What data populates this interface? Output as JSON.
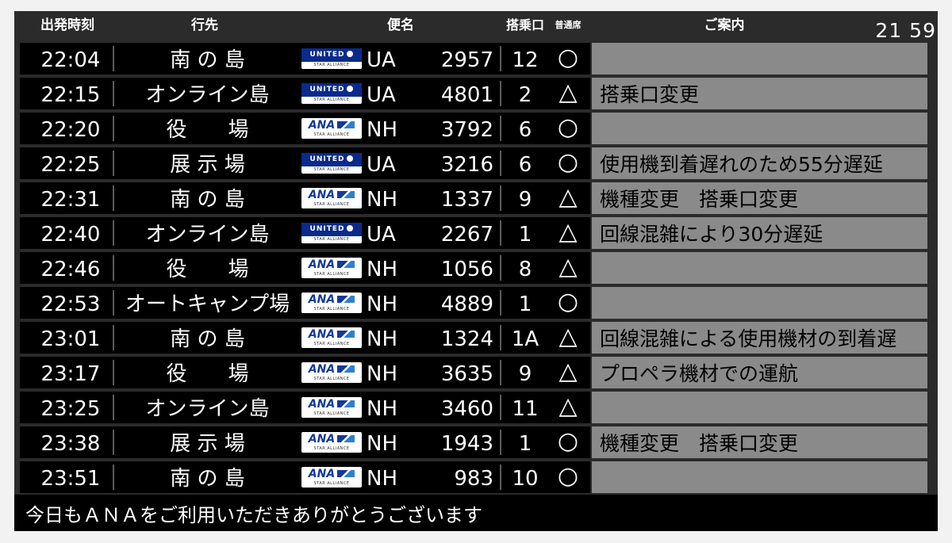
{
  "header": {
    "time_label": "出発時刻",
    "dest_label": "行先",
    "flight_label": "便名",
    "gate_label": "搭乗口",
    "seat_label": "普通席",
    "info_label": "ご案内",
    "clock": "21 59"
  },
  "colors": {
    "board": "#2b2b2b",
    "row": "#000000",
    "note": "#8a8a8a",
    "ua_blue": "#0a2a8c",
    "ana_blue": "#113a9c"
  },
  "flights": [
    {
      "time": "22:04",
      "dest": "南 の 島",
      "airline": "UA",
      "logo": "UNITED",
      "alliance": "STAR ALLIANCE",
      "number": "2957",
      "gate": "12",
      "seat": "○",
      "note": ""
    },
    {
      "time": "22:15",
      "dest": "オンライン島",
      "airline": "UA",
      "logo": "UNITED",
      "alliance": "STAR ALLIANCE",
      "number": "4801",
      "gate": "2",
      "seat": "△",
      "note": "搭乗口変更"
    },
    {
      "time": "22:20",
      "dest": "役　　場",
      "airline": "NH",
      "logo": "ANA",
      "alliance": "STAR ALLIANCE",
      "number": "3792",
      "gate": "6",
      "seat": "○",
      "note": ""
    },
    {
      "time": "22:25",
      "dest": "展 示 場",
      "airline": "UA",
      "logo": "UNITED",
      "alliance": "STAR ALLIANCE",
      "number": "3216",
      "gate": "6",
      "seat": "○",
      "note": "使用機到着遅れのため55分遅延"
    },
    {
      "time": "22:31",
      "dest": "南 の 島",
      "airline": "NH",
      "logo": "ANA",
      "alliance": "STAR ALLIANCE",
      "number": "1337",
      "gate": "9",
      "seat": "△",
      "note": "機種変更　搭乗口変更"
    },
    {
      "time": "22:40",
      "dest": "オンライン島",
      "airline": "UA",
      "logo": "UNITED",
      "alliance": "STAR ALLIANCE",
      "number": "2267",
      "gate": "1",
      "seat": "△",
      "note": "回線混雑により30分遅延"
    },
    {
      "time": "22:46",
      "dest": "役　　場",
      "airline": "NH",
      "logo": "ANA",
      "alliance": "STAR ALLIANCE",
      "number": "1056",
      "gate": "8",
      "seat": "△",
      "note": ""
    },
    {
      "time": "22:53",
      "dest": "オートキャンプ場",
      "airline": "NH",
      "logo": "ANA",
      "alliance": "STAR ALLIANCE",
      "number": "4889",
      "gate": "1",
      "seat": "○",
      "note": ""
    },
    {
      "time": "23:01",
      "dest": "南 の 島",
      "airline": "NH",
      "logo": "ANA",
      "alliance": "STAR ALLIANCE",
      "number": "1324",
      "gate": "1A",
      "seat": "△",
      "note": "回線混雑による使用機材の到着遅"
    },
    {
      "time": "23:17",
      "dest": "役　　場",
      "airline": "NH",
      "logo": "ANA",
      "alliance": "STAR ALLIANCE",
      "number": "3635",
      "gate": "9",
      "seat": "△",
      "note": "プロペラ機材での運航"
    },
    {
      "time": "23:25",
      "dest": "オンライン島",
      "airline": "NH",
      "logo": "ANA",
      "alliance": "STAR ALLIANCE",
      "number": "3460",
      "gate": "11",
      "seat": "△",
      "note": ""
    },
    {
      "time": "23:38",
      "dest": "展 示 場",
      "airline": "NH",
      "logo": "ANA",
      "alliance": "STAR ALLIANCE",
      "number": "1943",
      "gate": "1",
      "seat": "○",
      "note": "機種変更　搭乗口変更"
    },
    {
      "time": "23:51",
      "dest": "南 の 島",
      "airline": "NH",
      "logo": "ANA",
      "alliance": "STAR ALLIANCE",
      "number": "983",
      "gate": "10",
      "seat": "○",
      "note": ""
    }
  ],
  "footer": {
    "message": "今日もＡＮＡをご利用いただきありがとうございます"
  }
}
